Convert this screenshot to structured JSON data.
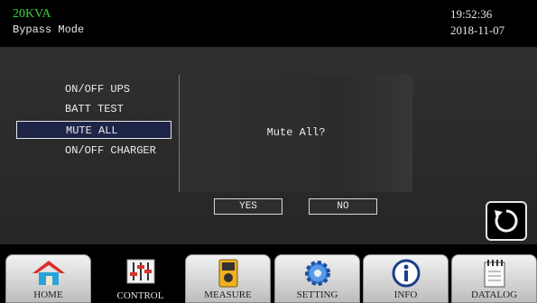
{
  "header": {
    "model": "20KVA",
    "mode": "Bypass Mode",
    "time": "19:52:36",
    "date": "2018-11-07"
  },
  "menu": {
    "items": [
      {
        "label": "ON/OFF UPS",
        "selected": false
      },
      {
        "label": "BATT TEST",
        "selected": false
      },
      {
        "label": "MUTE ALL",
        "selected": true
      },
      {
        "label": "ON/OFF CHARGER",
        "selected": false
      }
    ]
  },
  "dialog": {
    "message": "Mute All?",
    "yes_label": "YES",
    "no_label": "NO"
  },
  "nav": {
    "tabs": [
      {
        "label": "HOME",
        "icon": "house-icon",
        "active": false
      },
      {
        "label": "CONTROL",
        "icon": "sliders-icon",
        "active": true
      },
      {
        "label": "MEASURE",
        "icon": "meter-icon",
        "active": false
      },
      {
        "label": "SETTING",
        "icon": "gear-icon",
        "active": false
      },
      {
        "label": "INFO",
        "icon": "info-icon",
        "active": false
      },
      {
        "label": "DATALOG",
        "icon": "notebook-icon",
        "active": false
      }
    ]
  },
  "colors": {
    "model_text": "#3fd43f",
    "selected_bg": "#1e2448"
  }
}
